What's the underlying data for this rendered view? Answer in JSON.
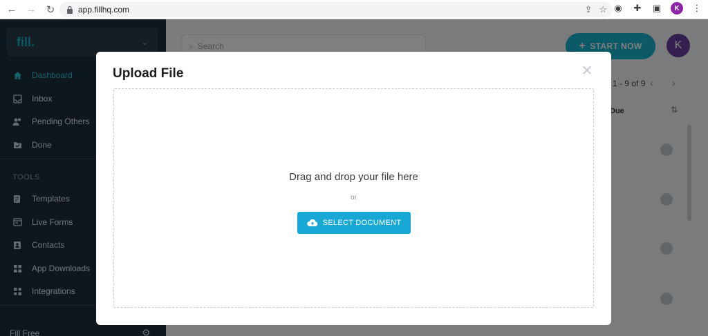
{
  "browser": {
    "url": "app.fillhq.com",
    "profile_initial": "K"
  },
  "sidebar": {
    "logo": "fill.",
    "items": [
      {
        "label": "Dashboard",
        "icon": "home-icon"
      },
      {
        "label": "Inbox",
        "icon": "inbox-icon"
      },
      {
        "label": "Pending Others",
        "icon": "users-icon"
      },
      {
        "label": "Done",
        "icon": "done-folder-icon"
      }
    ],
    "tools_label": "TOOLS",
    "tools": [
      {
        "label": "Templates",
        "icon": "templates-icon"
      },
      {
        "label": "Live Forms",
        "icon": "live-forms-icon"
      },
      {
        "label": "Contacts",
        "icon": "contacts-icon"
      },
      {
        "label": "App Downloads",
        "icon": "downloads-icon"
      },
      {
        "label": "Integrations",
        "icon": "integrations-icon"
      }
    ],
    "plan_label": "Fill Free"
  },
  "main": {
    "search_placeholder": "Search",
    "start_button": "START NOW",
    "avatar_initial": "K",
    "pager_text": "1 - 9 of 9",
    "due_header": "Due"
  },
  "modal": {
    "title": "Upload File",
    "drop_text": "Drag and drop your file here",
    "or_text": "or",
    "select_button": "SELECT DOCUMENT"
  },
  "colors": {
    "accent": "#17a8d6",
    "sidebar": "#1f2f3d",
    "active_nav": "#2ec4dd"
  }
}
